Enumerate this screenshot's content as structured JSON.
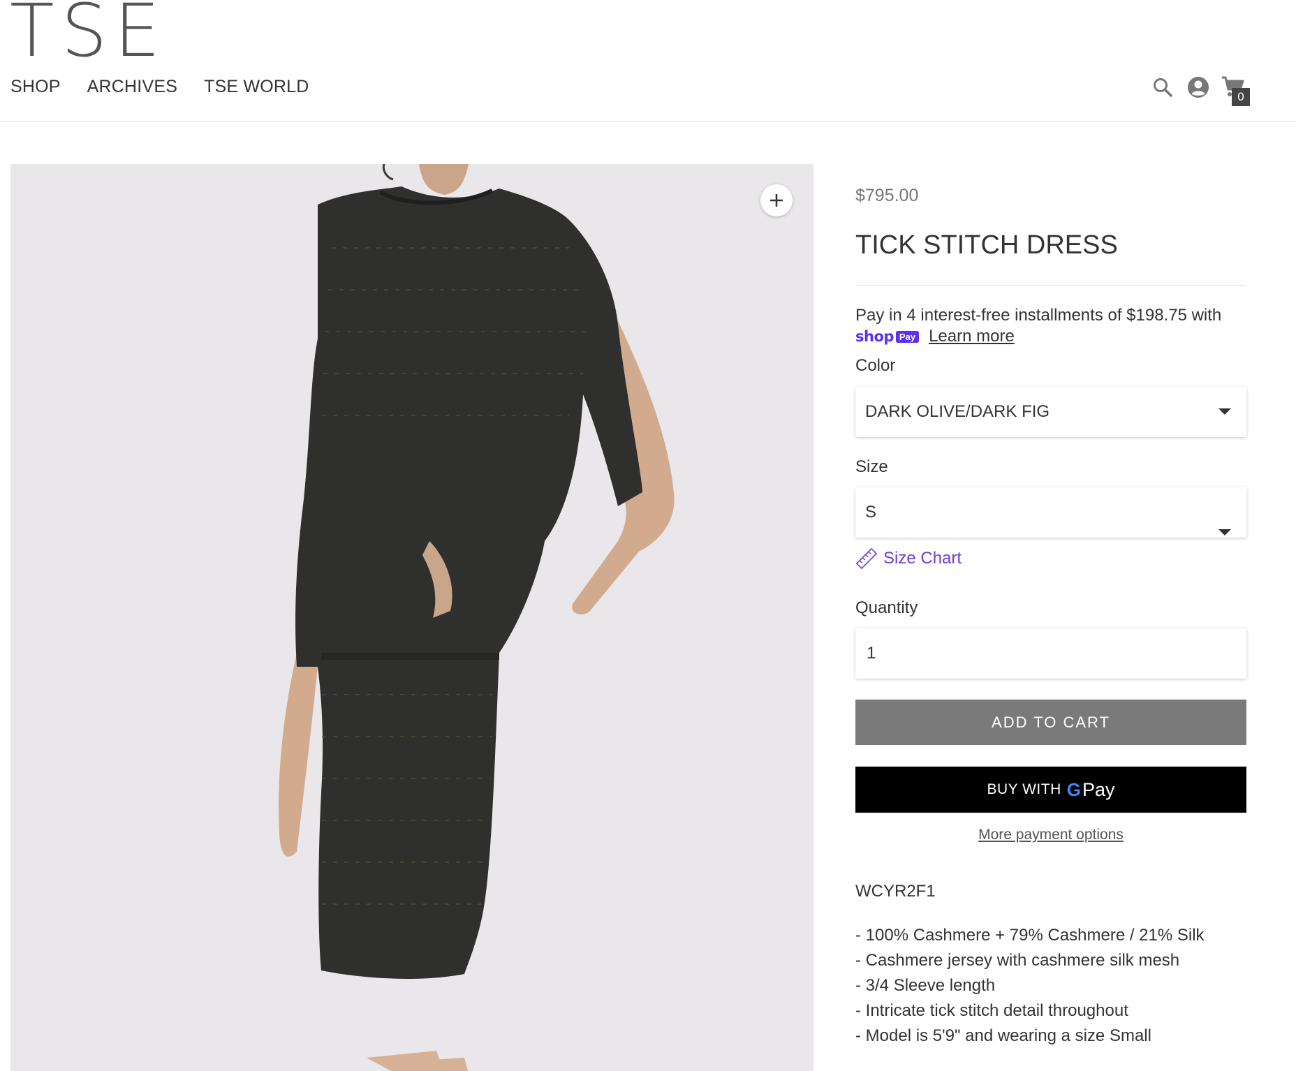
{
  "header": {
    "logo": "TSE",
    "nav": [
      {
        "label": "SHOP"
      },
      {
        "label": "ARCHIVES"
      },
      {
        "label": "TSE WORLD"
      }
    ],
    "cart_count": "0",
    "icons": [
      "search-icon",
      "account-icon",
      "cart-icon"
    ]
  },
  "gallery": {
    "zoom_icon": "plus-icon"
  },
  "product": {
    "price": "$795.00",
    "title": "TICK STITCH DRESS",
    "installments_text": "Pay in 4 interest-free installments of $198.75 with",
    "shoppay": {
      "shop": "shop",
      "pay": "Pay"
    },
    "learn_more": "Learn more",
    "color_label": "Color",
    "color_value": "DARK OLIVE/DARK FIG",
    "size_label": "Size",
    "size_value": "S",
    "size_chart": "Size Chart",
    "quantity_label": "Quantity",
    "quantity_value": "1",
    "add_to_cart": "ADD TO CART",
    "buy_with": "BUY WITH",
    "gpay_g": "G",
    "gpay_pay": "Pay",
    "more_payment": "More payment options",
    "sku": "WCYR2F1",
    "details": [
      "- 100% Cashmere + 79% Cashmere / 21% Silk",
      "- Cashmere jersey with cashmere silk mesh",
      "- 3/4 Sleeve length",
      "- Intricate tick stitch detail throughout",
      "- Model is 5'9\" and wearing a size Small"
    ]
  },
  "colors": {
    "accent": "#5a31f4",
    "size_chart": "#6b3fd3",
    "add_to_cart_bg": "#7a7a7a",
    "gpay_bg": "#000000",
    "image_bg": "#e9e7ea"
  }
}
